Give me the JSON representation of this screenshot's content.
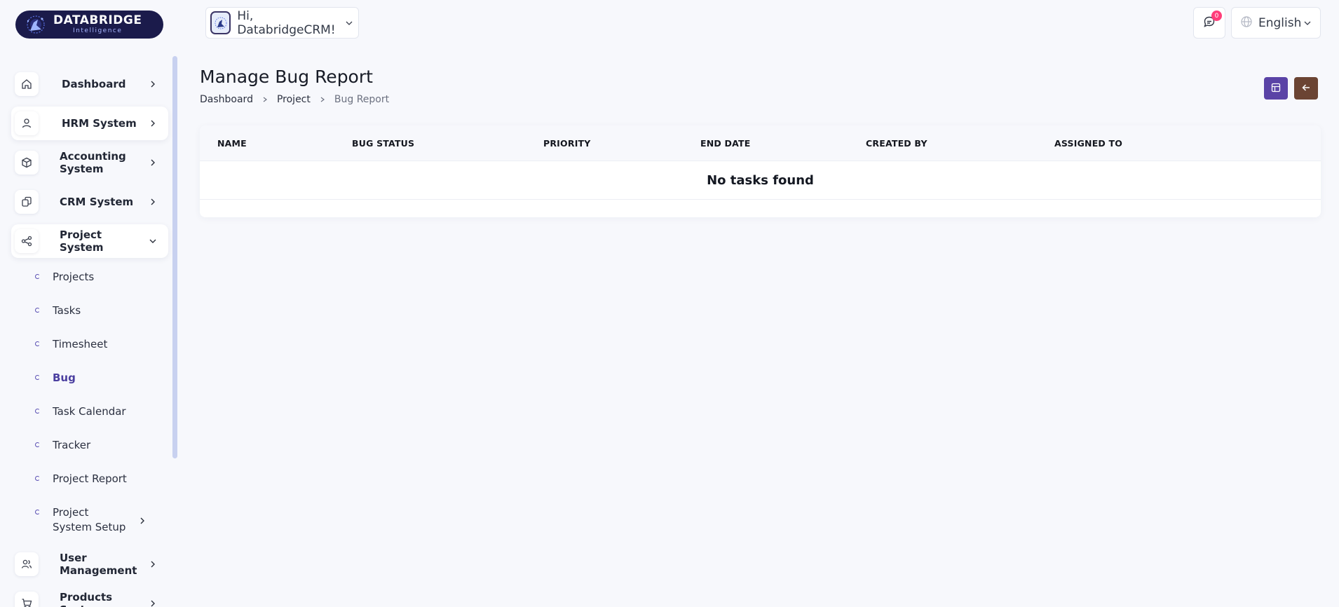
{
  "brand": {
    "line1": "DATABRIDGE",
    "line2": "Intelligence"
  },
  "topbar": {
    "greeting": "Hi, DatabridgeCRM!",
    "messages_badge": "0",
    "language": "English"
  },
  "sidebar": {
    "items": [
      {
        "label": "Dashboard"
      },
      {
        "label": "HRM System"
      },
      {
        "label": "Accounting System"
      },
      {
        "label": "CRM System"
      },
      {
        "label": "Project System"
      },
      {
        "label": "User Management"
      },
      {
        "label": "Products System"
      }
    ],
    "project_sub": [
      {
        "label": "Projects"
      },
      {
        "label": "Tasks"
      },
      {
        "label": "Timesheet"
      },
      {
        "label": "Bug"
      },
      {
        "label": "Task Calendar"
      },
      {
        "label": "Tracker"
      },
      {
        "label": "Project Report"
      },
      {
        "label": "Project System Setup"
      }
    ]
  },
  "page": {
    "title": "Manage Bug Report",
    "breadcrumb": [
      "Dashboard",
      "Project",
      "Bug Report"
    ]
  },
  "table": {
    "columns": [
      "NAME",
      "BUG STATUS",
      "PRIORITY",
      "END DATE",
      "CREATED BY",
      "ASSIGNED TO"
    ],
    "empty_message": "No tasks found"
  },
  "colors": {
    "primary": "#5a43a6",
    "back_button": "#6b4433",
    "active_sub_item": "#4b3fa0",
    "badge": "#ff3d7a",
    "brand_bg": "#1b1b4b"
  }
}
